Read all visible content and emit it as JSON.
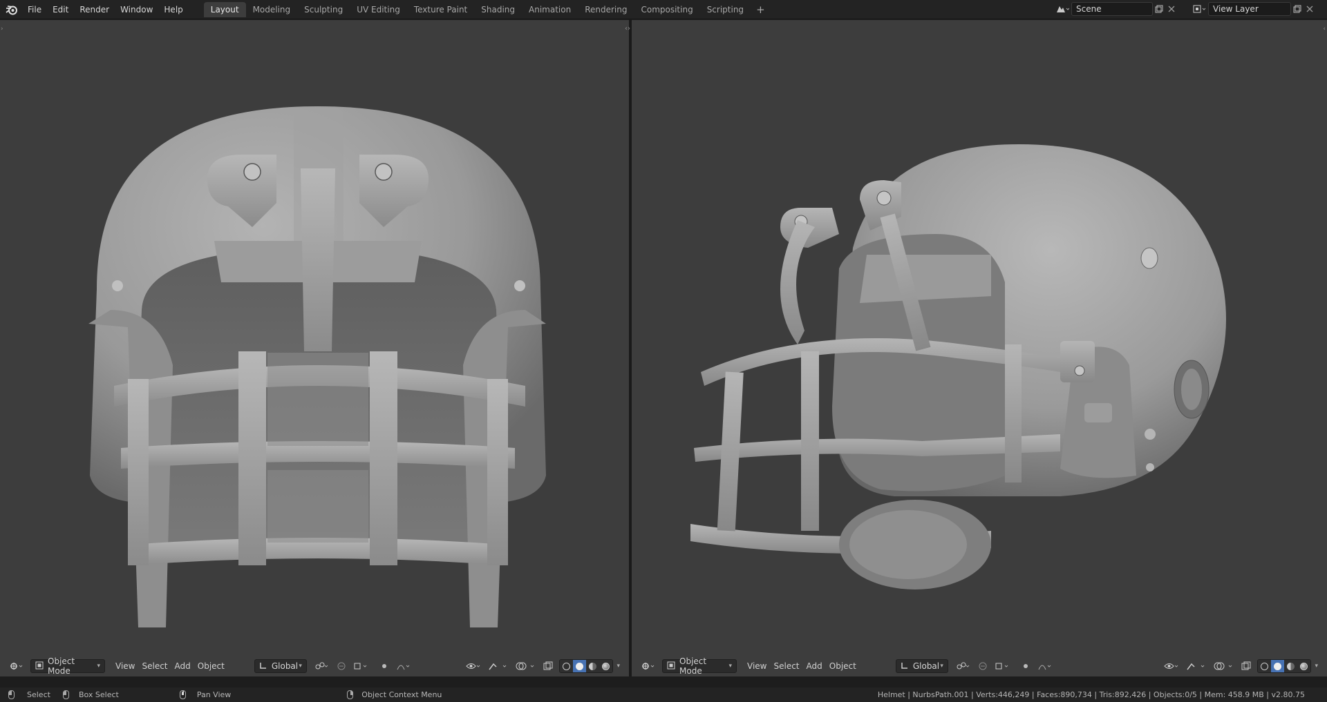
{
  "app": {
    "menu": [
      "File",
      "Edit",
      "Render",
      "Window",
      "Help"
    ],
    "workspaces": [
      "Layout",
      "Modeling",
      "Sculpting",
      "UV Editing",
      "Texture Paint",
      "Shading",
      "Animation",
      "Rendering",
      "Compositing",
      "Scripting"
    ],
    "active_workspace": "Layout",
    "add_workspace": "+",
    "scene": "Scene",
    "view_layer": "View Layer"
  },
  "viewport_left": {
    "mode": "Object Mode",
    "menus": [
      "View",
      "Select",
      "Add",
      "Object"
    ],
    "orientation": "Global",
    "view": "front",
    "subject": "Helmet"
  },
  "viewport_right": {
    "mode": "Object Mode",
    "menus": [
      "View",
      "Select",
      "Add",
      "Object"
    ],
    "orientation": "Global",
    "view": "three-quarter",
    "subject": "Helmet"
  },
  "statusbar": {
    "select": "Select",
    "box_select": "Box Select",
    "pan_view": "Pan View",
    "context_menu": "Object Context Menu",
    "info": "Helmet | NurbsPath.001 | Verts:446,249 | Faces:890,734 | Tris:892,426 | Objects:0/5 | Mem: 458.9 MB | v2.80.75"
  },
  "colors": {
    "viewport_bg": "#3d3d3d",
    "active_shading": "#4772b3",
    "helmet_shell": "#a9a9a9"
  },
  "icons": [
    "blender-logo-icon",
    "editor-type-icon",
    "object-mode-icon",
    "orientation-icon",
    "snap-icon",
    "proportional-icon",
    "overlay-icon",
    "gizmo-icon",
    "xray-icon",
    "shading-wire-icon",
    "shading-solid-icon",
    "shading-material-icon",
    "shading-rendered-icon",
    "scene-icon",
    "view-layer-icon"
  ]
}
